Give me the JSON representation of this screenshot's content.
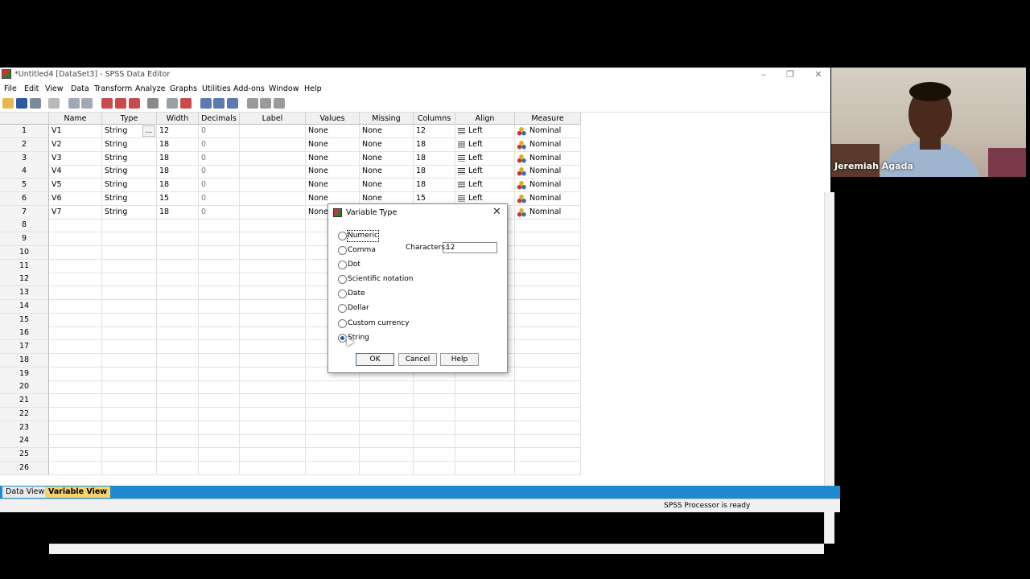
{
  "window": {
    "title": "*Untitled4 [DataSet3] - SPSS Data Editor",
    "controls": [
      "–",
      "❐",
      "✕"
    ]
  },
  "menu": [
    "File",
    "Edit",
    "View",
    "Data",
    "Transform",
    "Analyze",
    "Graphs",
    "Utilities",
    "Add-ons",
    "Window",
    "Help"
  ],
  "grid": {
    "headers": [
      "Name",
      "Type",
      "Width",
      "Decimals",
      "Label",
      "Values",
      "Missing",
      "Columns",
      "Align",
      "Measure"
    ],
    "rows": [
      {
        "num": "1",
        "name": "V1",
        "type": "String",
        "width": "12",
        "decimals": "0",
        "label": "",
        "values": "None",
        "missing": "None",
        "columns": "12",
        "align": "Left",
        "measure": "Nominal"
      },
      {
        "num": "2",
        "name": "V2",
        "type": "String",
        "width": "18",
        "decimals": "0",
        "label": "",
        "values": "None",
        "missing": "None",
        "columns": "18",
        "align": "Left",
        "measure": "Nominal"
      },
      {
        "num": "3",
        "name": "V3",
        "type": "String",
        "width": "18",
        "decimals": "0",
        "label": "",
        "values": "None",
        "missing": "None",
        "columns": "18",
        "align": "Left",
        "measure": "Nominal"
      },
      {
        "num": "4",
        "name": "V4",
        "type": "String",
        "width": "18",
        "decimals": "0",
        "label": "",
        "values": "None",
        "missing": "None",
        "columns": "18",
        "align": "Left",
        "measure": "Nominal"
      },
      {
        "num": "5",
        "name": "V5",
        "type": "String",
        "width": "18",
        "decimals": "0",
        "label": "",
        "values": "None",
        "missing": "None",
        "columns": "18",
        "align": "Left",
        "measure": "Nominal"
      },
      {
        "num": "6",
        "name": "V6",
        "type": "String",
        "width": "15",
        "decimals": "0",
        "label": "",
        "values": "None",
        "missing": "None",
        "columns": "15",
        "align": "Left",
        "measure": "Nominal"
      },
      {
        "num": "7",
        "name": "V7",
        "type": "String",
        "width": "18",
        "decimals": "0",
        "label": "",
        "values": "None",
        "missing": "",
        "columns": "",
        "align": "",
        "measure": "Nominal"
      }
    ],
    "empty_rows": [
      "8",
      "9",
      "10",
      "11",
      "12",
      "13",
      "14",
      "15",
      "16",
      "17",
      "18",
      "19",
      "20",
      "21",
      "22",
      "23",
      "24",
      "25",
      "26"
    ],
    "type_cell_button": "..."
  },
  "tabs": {
    "data_view": "Data View",
    "variable_view": "Variable View"
  },
  "status": "SPSS  Processor is ready",
  "dialog": {
    "title": "Variable Type",
    "close": "✕",
    "options": [
      "Numeric",
      "Comma",
      "Dot",
      "Scientific notation",
      "Date",
      "Dollar",
      "Custom currency",
      "String"
    ],
    "selected": "String",
    "characters_label": "Characters:",
    "characters_value": "12",
    "ok": "OK",
    "cancel": "Cancel",
    "help": "Help"
  },
  "webcam": {
    "name": "Jeremiah Agada"
  }
}
